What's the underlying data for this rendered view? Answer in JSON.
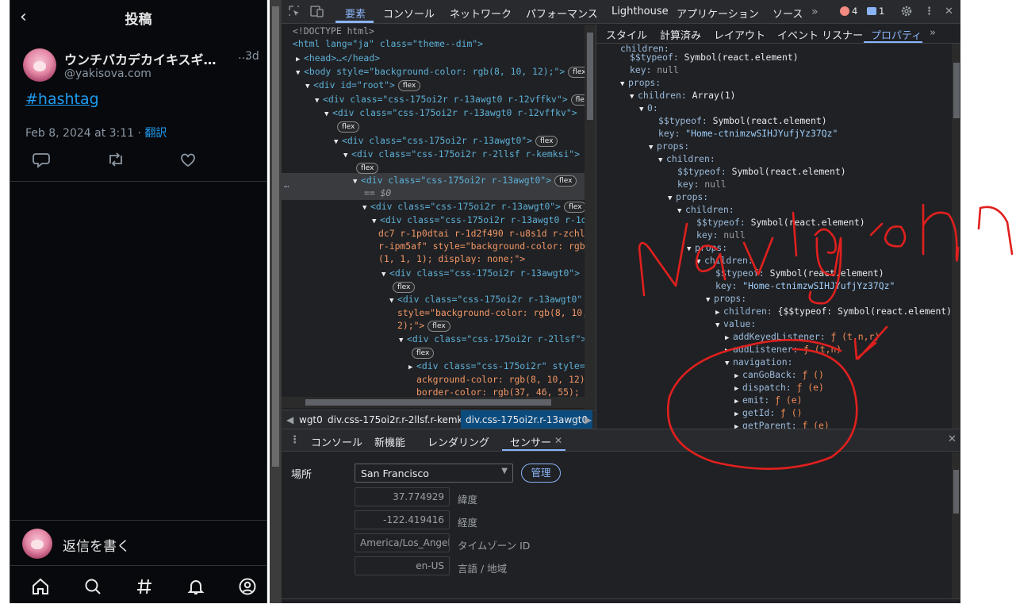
{
  "tweet": {
    "header_title": "投稿",
    "back_icon": "‹",
    "user_name": "ウンチバカデカイキスギ…",
    "user_handle": "@yakisova.com",
    "more": "…",
    "time_ago": "3d",
    "hashtag": "#hashtag",
    "date": "Feb 8, 2024 at 3:11 · ",
    "translate": "翻訳",
    "reply_prompt": "返信を書く"
  },
  "devtools": {
    "main_tabs": [
      "要素",
      "コンソール",
      "ネットワーク",
      "パフォーマンス",
      "Lighthouse",
      "アプリケーション",
      "ソース"
    ],
    "error_count": "4",
    "message_count": "1",
    "right_tabs": [
      "スタイル",
      "計算済み",
      "レイアウト",
      "イベント リスナー",
      "プロパティ"
    ],
    "breadcrumbs": [
      "wgt0",
      "div.css-175oi2r.r-2llsf.r-kemksi",
      "div.css-175oi2r.r-13awgt0"
    ],
    "drawer_tabs": [
      "コンソール",
      "新機能",
      "レンダリング",
      "センサー"
    ],
    "sensor": {
      "location_label": "場所",
      "location_value": "San Francisco",
      "manage_label": "管理",
      "fields": [
        {
          "value": "37.774929",
          "label": "緯度"
        },
        {
          "value": "-122.419416",
          "label": "経度"
        },
        {
          "value": "America/Los_Angeles",
          "label": "タイムゾーン ID"
        },
        {
          "value": "en-US",
          "label": "言語 / 地域"
        }
      ]
    },
    "elements_lines": [
      "<!DOCTYPE html>",
      "<html lang=\"ja\" class=\"theme--dim\">",
      "<head>…</head>",
      "<body style=\"background-color: rgb(8, 10, 12);\">",
      "<div id=\"root\">",
      "<div class=\"css-175oi2r r-13awgt0 r-12vffkv\">",
      "<div class=\"css-175oi2r r-13awgt0 r-12vffkv\">",
      "<div class=\"css-175oi2r r-13awgt0\">",
      "<div class=\"css-175oi2r r-2llsf r-kemksi\">",
      "<div class=\"css-175oi2r r-13awgt0\">",
      "== $0",
      "<div class=\"css-175oi2r r-13awgt0\">",
      "<div class=\"css-175oi2r r-13awgt0 r-1d5b",
      "dc7 r-1p0dtai r-1d2f490 r-u8s1d r-zchlnj",
      "r-ipm5af\" style=\"background-color: rgb",
      "(1, 1, 1); display: none;\">",
      "<div class=\"css-175oi2r r-13awgt0\">",
      "<div class=\"css-175oi2r r-13awgt0\"",
      "style=\"background-color: rgb(8, 10,",
      "2);\">",
      "<div class=\"css-175oi2r r-2llsf\">",
      "<div class=\"css-175oi2r\" style=\"",
      "ackground-color: rgb(8, 10, 12);",
      "border-color: rgb(37, 46, 55); p"
    ],
    "badge_label": "flex",
    "props_lines": [
      "children:",
      "$$typeof: Symbol(react.element)",
      "key: null",
      "props:",
      "children: Array(1)",
      "0:",
      "$$typeof: Symbol(react.element)",
      "key: \"Home-ctnimzwSIHJYufjYz37Qz\"",
      "props:",
      "children:",
      "$$typeof: Symbol(react.element)",
      "key: null",
      "props:",
      "children:",
      "$$typeof: Symbol(react.element)",
      "key: null",
      "props:",
      "children:",
      "$$typeof: Symbol(react.element)",
      "key: \"Home-ctnimzwSIHJYufjYz37Qz\"",
      "props:",
      "children: {$$typeof: Symbol(react.element),",
      "value:",
      "addKeyedListener: ƒ (t,n,r)",
      "addListener: ƒ (t,n)",
      "navigation:",
      "canGoBack: ƒ ()",
      "dispatch: ƒ (e)",
      "emit: ƒ (e)",
      "getId: ƒ ()",
      "getParent: ƒ (e)"
    ]
  },
  "annotation": {
    "text": "navigation",
    "color": "#e0201e"
  },
  "colors": {
    "twitter_bg": "#08090c",
    "twitter_link": "#1d9bf0",
    "devtools_bg": "#202124",
    "devtools_accent": "#8ab4f8"
  }
}
